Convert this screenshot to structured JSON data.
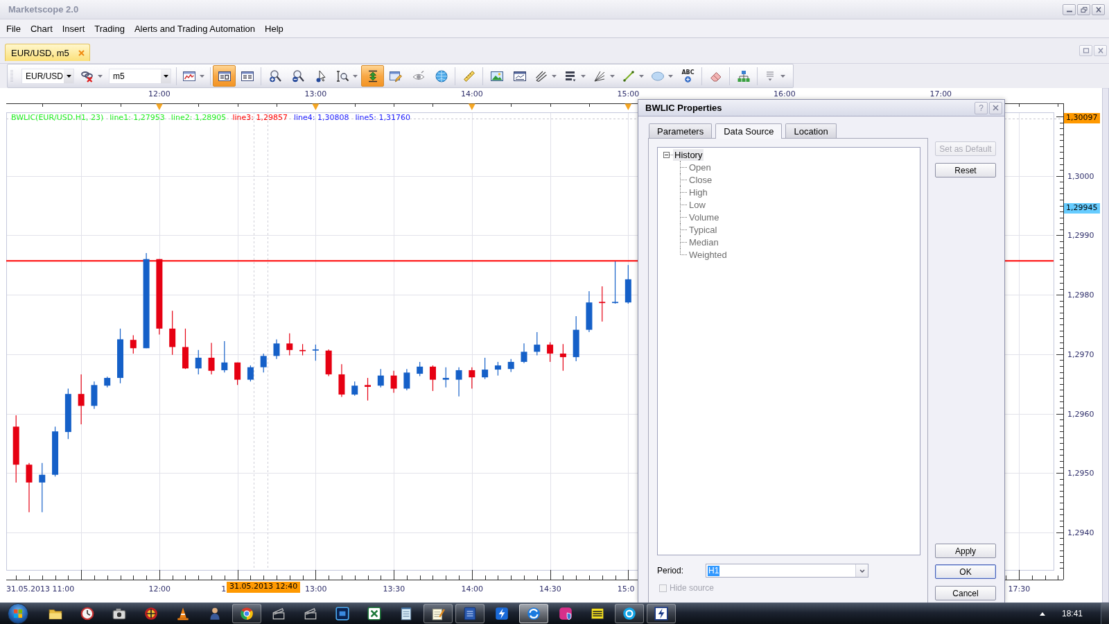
{
  "window": {
    "title": "Marketscope 2.0"
  },
  "menu": [
    "File",
    "Chart",
    "Insert",
    "Trading",
    "Alerts and Trading Automation",
    "Help"
  ],
  "document_tabs": [
    {
      "label": "EUR/USD, m5",
      "selected": true
    }
  ],
  "toolbar": {
    "items": [
      {
        "kind": "combo",
        "value": "EUR/USD"
      },
      {
        "kind": "tool",
        "on": false,
        "menu": true
      },
      {
        "kind": "combo",
        "value": "m5"
      },
      {
        "kind": "separator"
      },
      {
        "kind": "tool",
        "on": false,
        "menu": true
      },
      {
        "kind": "separator"
      },
      {
        "kind": "tool",
        "on": true,
        "menu": false
      },
      {
        "kind": "tool",
        "on": false,
        "menu": false
      },
      {
        "kind": "separator"
      },
      {
        "kind": "tool",
        "on": false,
        "menu": false
      },
      {
        "kind": "tool",
        "on": false,
        "menu": false
      },
      {
        "kind": "tool",
        "on": false,
        "menu": false
      },
      {
        "kind": "tool",
        "on": false,
        "menu": true
      },
      {
        "kind": "tool",
        "on": true,
        "menu": false
      },
      {
        "kind": "tool",
        "on": false,
        "menu": false
      },
      {
        "kind": "tool",
        "on": false,
        "menu": false
      },
      {
        "kind": "tool",
        "on": false,
        "menu": false
      },
      {
        "kind": "separator"
      },
      {
        "kind": "tool",
        "on": false,
        "menu": false
      },
      {
        "kind": "separator"
      },
      {
        "kind": "tool",
        "on": false,
        "menu": false
      },
      {
        "kind": "tool",
        "on": false,
        "menu": false
      },
      {
        "kind": "tool",
        "on": false,
        "menu": true
      },
      {
        "kind": "tool",
        "on": false,
        "menu": true
      },
      {
        "kind": "tool",
        "on": false,
        "menu": true
      },
      {
        "kind": "tool",
        "on": false,
        "menu": true
      },
      {
        "kind": "tool",
        "on": false,
        "menu": true
      },
      {
        "kind": "tool",
        "on": false,
        "menu": false,
        "label": "ABC"
      },
      {
        "kind": "separator"
      },
      {
        "kind": "tool",
        "on": false,
        "menu": false
      },
      {
        "kind": "separator"
      },
      {
        "kind": "tool",
        "on": false,
        "menu": false
      },
      {
        "kind": "separator"
      },
      {
        "kind": "tool",
        "on": false,
        "menu": true
      }
    ]
  },
  "chart": {
    "top_axis": [
      "12:00",
      "13:00",
      "14:00",
      "15:00",
      "16:00",
      "17:00"
    ],
    "indicator": {
      "name": "BWLIC(EUR/USD.H1, 23)",
      "lines": [
        {
          "label": "line1: 1,27953",
          "color": "#22ee22"
        },
        {
          "label": "line2: 1,28905",
          "color": "#22ee22"
        },
        {
          "label": "line3: 1,29857",
          "color": "#ff0000"
        },
        {
          "label": "line4: 1,30808",
          "color": "#2222ff"
        },
        {
          "label": "line5: 1,31760",
          "color": "#2222ff"
        }
      ]
    },
    "price_axis": [
      "1,3000",
      "1,2990",
      "1,2980",
      "1,2970",
      "1,2960",
      "1,2950",
      "1,2940"
    ],
    "price_tags": [
      {
        "label": "1,30097",
        "color": "#ff9900"
      },
      {
        "label": "1,29945",
        "color": "#66ccff"
      }
    ],
    "time_axis": [
      "31.05.2013 11:00",
      "12:00",
      "1",
      "13:00",
      "13:30",
      "14:00",
      "14:30",
      "15:0",
      "17:30"
    ],
    "cursor_time": "31.05.2013 12:40"
  },
  "dialog": {
    "title": "BWLIC Properties",
    "help": "?",
    "tabs": [
      {
        "label": "Parameters",
        "selected": false
      },
      {
        "label": "Data Source",
        "selected": true
      },
      {
        "label": "Location",
        "selected": false
      }
    ],
    "tree": [
      {
        "label": "History",
        "expanded": true,
        "selected": true,
        "disabled": false,
        "children": [
          {
            "label": "Open",
            "selected": false,
            "disabled": true
          },
          {
            "label": "Close",
            "selected": false,
            "disabled": true
          },
          {
            "label": "High",
            "selected": false,
            "disabled": true
          },
          {
            "label": "Low",
            "selected": false,
            "disabled": true
          },
          {
            "label": "Volume",
            "selected": false,
            "disabled": true
          },
          {
            "label": "Typical",
            "selected": false,
            "disabled": true
          },
          {
            "label": "Median",
            "selected": false,
            "disabled": true
          },
          {
            "label": "Weighted",
            "selected": false,
            "disabled": true
          }
        ]
      }
    ],
    "side_buttons": [
      {
        "label": "Set as Default",
        "disabled": true
      },
      {
        "label": "Reset",
        "disabled": false
      }
    ],
    "period": {
      "label": "Period:",
      "value": "H1",
      "focused": true
    },
    "hide_source": {
      "label": "Hide source",
      "checked": false,
      "disabled": true
    },
    "footer_buttons": [
      {
        "label": "Apply",
        "default": false
      },
      {
        "label": "OK",
        "default": true
      },
      {
        "label": "Cancel",
        "default": false
      }
    ]
  },
  "taskbar": {
    "apps": [
      {
        "running": false,
        "selected": false
      },
      {
        "running": false,
        "selected": false
      },
      {
        "running": false,
        "selected": false
      },
      {
        "running": false,
        "selected": false
      },
      {
        "running": false,
        "selected": false
      },
      {
        "running": false,
        "selected": false
      },
      {
        "running": true,
        "selected": false
      },
      {
        "running": false,
        "selected": false
      },
      {
        "running": false,
        "selected": false
      },
      {
        "running": false,
        "selected": false
      },
      {
        "running": false,
        "selected": false
      },
      {
        "running": false,
        "selected": false
      },
      {
        "running": true,
        "selected": false
      },
      {
        "running": true,
        "selected": false
      },
      {
        "running": false,
        "selected": false
      },
      {
        "running": true,
        "selected": true
      },
      {
        "running": false,
        "selected": false
      },
      {
        "running": false,
        "selected": false
      },
      {
        "running": true,
        "selected": false
      },
      {
        "running": true,
        "selected": false
      }
    ],
    "clock": "18:41"
  }
}
